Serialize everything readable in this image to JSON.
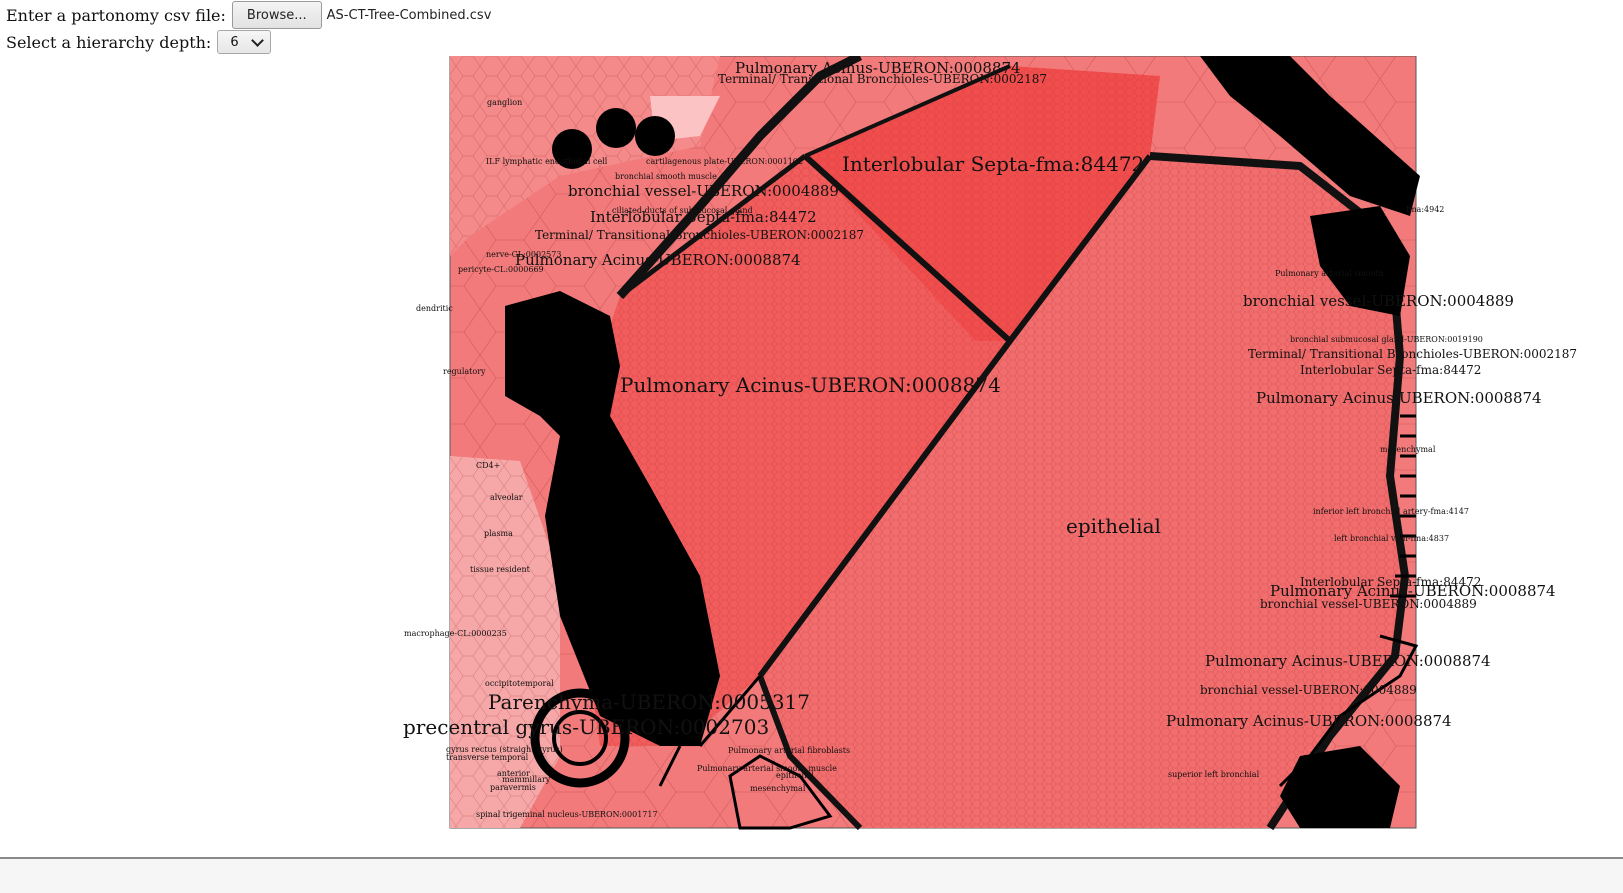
{
  "controls": {
    "file_label": "Enter a partonomy csv file:",
    "browse_label": "Browse...",
    "file_name": "AS-CT-Tree-Combined.csv",
    "depth_label": "Select a hierarchy depth:",
    "depth_value": "6"
  },
  "colors": {
    "fill_dark": "#f24d4d",
    "fill_mid": "#f07070",
    "fill_light": "#f7a3a3",
    "fill_pale": "#fbc3c3",
    "stroke": "#000000"
  },
  "voronoi_labels": [
    {
      "name": "lbl-interlobular-top",
      "text": "Interlobular Septa-fma:84472",
      "size": "large"
    },
    {
      "name": "lbl-acinus-center",
      "text": "Pulmonary Acinus-UBERON:0008874",
      "size": "large"
    },
    {
      "name": "lbl-epithelial",
      "text": "epithelial",
      "size": "large"
    },
    {
      "name": "lbl-parenchyma",
      "text": "Parenchyma-UBERON:0005317",
      "size": "large"
    },
    {
      "name": "lbl-precentral",
      "text": "precentral gyrus-UBERON:0002703",
      "size": "large"
    },
    {
      "name": "lbl-pulmonary-top",
      "text": "Pulmonary Acinus-UBERON:0008874",
      "size": "medium"
    },
    {
      "name": "lbl-bronchial-vessel-left",
      "text": "bronchial vessel-UBERON:0004889",
      "size": "medium"
    },
    {
      "name": "lbl-interlobular-left",
      "text": "Interlobular Septa-fma:84472",
      "size": "medium"
    },
    {
      "name": "lbl-terminal-left",
      "text": "Terminal/ Transitional Bronchioles-UBERON:0002187",
      "size": "small"
    },
    {
      "name": "lbl-pulmonary-acinus-left",
      "text": "Pulmonary Acinus-UBERON:0008874",
      "size": "medium"
    },
    {
      "name": "lbl-terminal-top",
      "text": "Terminal/ Transitional Bronchioles-UBERON:0002187",
      "size": "small"
    },
    {
      "name": "lbl-bronchial-vessel-right",
      "text": "bronchial vessel-UBERON:0004889",
      "size": "medium"
    },
    {
      "name": "lbl-terminal-right",
      "text": "Terminal/ Transitional Bronchioles-UBERON:0002187",
      "size": "small"
    },
    {
      "name": "lbl-interlobular-right",
      "text": "Interlobular Septa-fma:84472",
      "size": "small"
    },
    {
      "name": "lbl-pulmonary-right",
      "text": "Pulmonary Acinus-UBERON:0008874",
      "size": "medium"
    },
    {
      "name": "lbl-inferior-left-bronchial",
      "text": "inferior left bronchial artery-fma:4147",
      "size": "tiny"
    },
    {
      "name": "lbl-left-bronchial-vein",
      "text": "left bronchial vein-fma:4837",
      "size": "tiny"
    },
    {
      "name": "lbl-interlobular-right-low",
      "text": "Interlobular Septa-fma:84472",
      "size": "small"
    },
    {
      "name": "lbl-pulmonary-right-low",
      "text": "Pulmonary Acinus-UBERON:0008874",
      "size": "medium"
    },
    {
      "name": "lbl-bronchial-vessel-right-low",
      "text": "bronchial vessel-UBERON:0004889",
      "size": "small"
    },
    {
      "name": "lbl-pulmonary-right-lower",
      "text": "Pulmonary Acinus-UBERON:0008874",
      "size": "medium"
    },
    {
      "name": "lbl-bronchial-vessel-right-lower",
      "text": "bronchial vessel-UBERON:0004889",
      "size": "small"
    },
    {
      "name": "lbl-pulmonary-bottom",
      "text": "Pulmonary Acinus-UBERON:0008874",
      "size": "medium"
    },
    {
      "name": "lbl-pericyte",
      "text": "pericyte-CL:0000669",
      "size": "tiny"
    },
    {
      "name": "lbl-nerve",
      "text": "nerve-CL:0002573",
      "size": "tiny"
    },
    {
      "name": "lbl-ganglion",
      "text": "ganglion",
      "size": "tiny"
    },
    {
      "name": "lbl-macrophage",
      "text": "macrophage-CL:0000235",
      "size": "tiny"
    },
    {
      "name": "lbl-spinal-trigeminal",
      "text": "spinal trigeminal nucleus-UBERON:0001717",
      "size": "tiny"
    },
    {
      "name": "lbl-ciliated",
      "text": "ciliated ducts of submucosal gland",
      "size": "tiny"
    },
    {
      "name": "lbl-superior-left",
      "text": "superior left bronchial",
      "size": "tiny"
    },
    {
      "name": "lbl-mesenchymal",
      "text": "mesenchymal",
      "size": "tiny"
    },
    {
      "name": "lbl-epithelial-small",
      "text": "epithelial",
      "size": "tiny"
    },
    {
      "name": "lbl-pulmonary-arterial-smooth",
      "text": "Pulmonary arterial smooth muscle",
      "size": "tiny"
    },
    {
      "name": "lbl-pulmonary-arterial-fibro",
      "text": "Pulmonary arterial fibroblasts",
      "size": "tiny"
    },
    {
      "name": "lbl-ilf-lymphatic",
      "text": "ILF lymphatic endothelial cell",
      "size": "tiny"
    },
    {
      "name": "lbl-cartilagenous",
      "text": "cartilagenous plate-UBERON:0001102",
      "size": "tiny"
    },
    {
      "name": "lbl-bronchial-smooth",
      "text": "bronchial smooth muscle",
      "size": "tiny"
    },
    {
      "name": "lbl-gyrus-rectus",
      "text": "gyrus rectus (straight gyrus)",
      "size": "tiny"
    },
    {
      "name": "lbl-transverse-temporal",
      "text": "transverse temporal",
      "size": "tiny"
    },
    {
      "name": "lbl-paravermis",
      "text": "paravermis",
      "size": "tiny"
    },
    {
      "name": "lbl-mammillary",
      "text": "mammillary",
      "size": "tiny"
    },
    {
      "name": "lbl-anterior",
      "text": "anterior",
      "size": "tiny"
    },
    {
      "name": "lbl-occipital",
      "text": "occipitotemporal",
      "size": "tiny"
    },
    {
      "name": "lbl-dendritic",
      "text": "dendritic",
      "size": "tiny"
    },
    {
      "name": "lbl-regulatory",
      "text": "regulatory",
      "size": "tiny"
    },
    {
      "name": "lbl-plasma",
      "text": "plasma",
      "size": "tiny"
    },
    {
      "name": "lbl-tissue",
      "text": "tissue resident",
      "size": "tiny"
    },
    {
      "name": "lbl-alveolar",
      "text": "alveolar",
      "size": "tiny"
    },
    {
      "name": "lbl-cd4",
      "text": "CD4+",
      "size": "tiny"
    },
    {
      "name": "lbl-mesenchymal-right",
      "text": "mesenchymal",
      "size": "tiny"
    },
    {
      "name": "lbl-bronchial-ciliated",
      "text": "bronchial submucosal gland-UBERON:0019190",
      "size": "tiny"
    },
    {
      "name": "lbl-pulmonary-arterial-right",
      "text": "Pulmonary arterial smooth",
      "size": "tiny"
    },
    {
      "name": "lbl-fma4942",
      "text": "fma:4942",
      "size": "tiny"
    }
  ]
}
